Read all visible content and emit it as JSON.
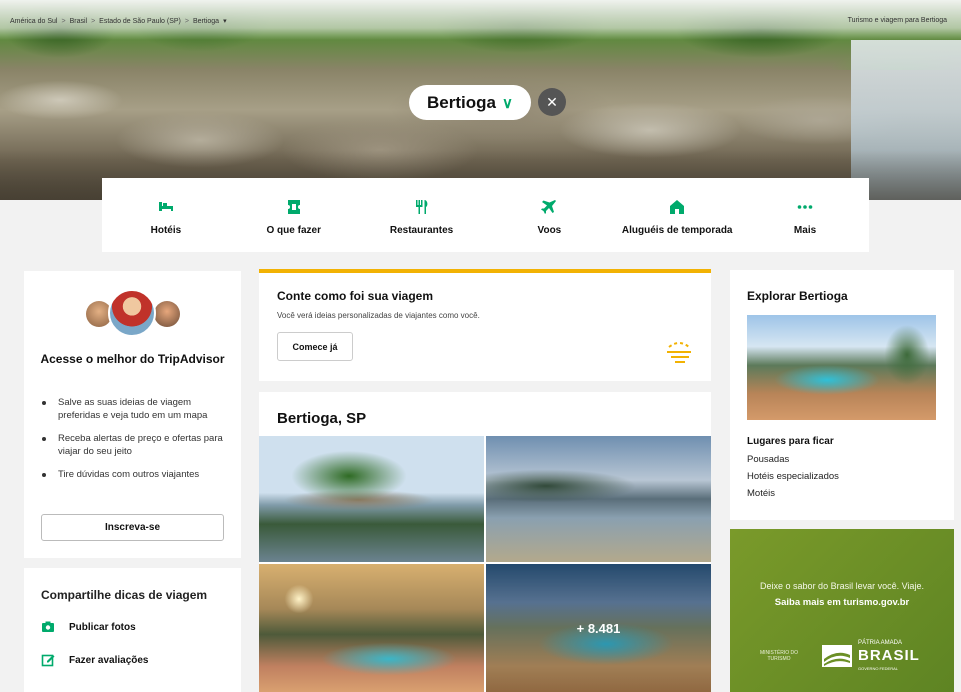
{
  "breadcrumb": [
    "América do Sul",
    "Brasil",
    "Estado de São Paulo (SP)",
    "Bertioga"
  ],
  "breadcrumb_separator": ">",
  "breadcrumb_caret": "▾",
  "top_link": "Turismo e viagem para Bertioga",
  "city": {
    "name": "Bertioga",
    "chevron": "∨",
    "close": "✕"
  },
  "nav": [
    {
      "label": "Hotéis",
      "icon": "bed-icon"
    },
    {
      "label": "O que fazer",
      "icon": "ticket-icon"
    },
    {
      "label": "Restaurantes",
      "icon": "fork-knife-icon"
    },
    {
      "label": "Voos",
      "icon": "plane-icon"
    },
    {
      "label": "Aluguéis de temporada",
      "icon": "house-icon"
    },
    {
      "label": "Mais",
      "icon": "more-dots-icon"
    }
  ],
  "signup": {
    "title": "Acesse o melhor do TripAdvisor",
    "benefits": [
      "Salve as suas ideias de viagem preferidas e veja tudo em um mapa",
      "Receba alertas de preço e ofertas para viajar do seu jeito",
      "Tire dúvidas com outros viajantes"
    ],
    "button": "Inscreva-se"
  },
  "share": {
    "title": "Compartilhe dicas de viagem",
    "items": [
      {
        "label": "Publicar fotos",
        "icon": "camera-icon"
      },
      {
        "label": "Fazer avaliações",
        "icon": "edit-icon"
      }
    ]
  },
  "prompt": {
    "title": "Conte como foi sua viagem",
    "subtitle": "Você verá ideias personalizadas de viajantes como você.",
    "button": "Comece já"
  },
  "gallery": {
    "title": "Bertioga, SP",
    "more_count": "+ 8.481"
  },
  "explore": {
    "title": "Explorar Bertioga",
    "subtitle": "Lugares para ficar",
    "links": [
      "Pousadas",
      "Hotéis especializados",
      "Motéis"
    ]
  },
  "ad": {
    "line1": "Deixe o sabor do Brasil levar você. Viaje.",
    "line2": "Saiba mais em turismo.gov.br",
    "ministry": "MINISTÉRIO DO",
    "ministry2": "TURISMO",
    "brand_small": "PÁTRIA AMADA",
    "brand_big": "BRASIL",
    "brand_tiny": "GOVERNO FEDERAL"
  },
  "colors": {
    "accent_green": "#00aa6c",
    "prompt_yellow": "#f2b203",
    "ad_green": "#6b8f26"
  }
}
